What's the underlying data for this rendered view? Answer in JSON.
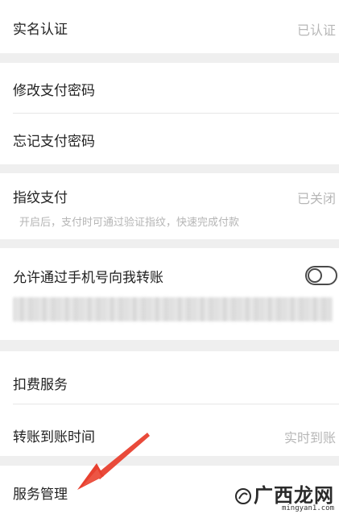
{
  "items": {
    "real_name": {
      "label": "实名认证",
      "value": "已认证"
    },
    "change_pay_password": {
      "label": "修改支付密码"
    },
    "forgot_pay_password": {
      "label": "忘记支付密码"
    },
    "fingerprint_pay": {
      "label": "指纹支付",
      "value": "已关闭",
      "hint": "开启后，支付时可通过验证指纹，快速完成付款"
    },
    "phone_transfer": {
      "label": "允许通过手机号向我转账",
      "toggle_on": false
    },
    "deduction_service": {
      "label": "扣费服务"
    },
    "transfer_arrival_time": {
      "label": "转账到账时间",
      "value": "实时到账"
    },
    "service_management": {
      "label": "服务管理"
    }
  },
  "watermark": {
    "brand": "广西龙网",
    "url": "mingyan1.com"
  },
  "colors": {
    "background": "#efefef",
    "row": "#ffffff",
    "label": "#222222",
    "value": "#b7b7b7",
    "hint": "#b5b5b5",
    "arrow": "#e8402f"
  }
}
